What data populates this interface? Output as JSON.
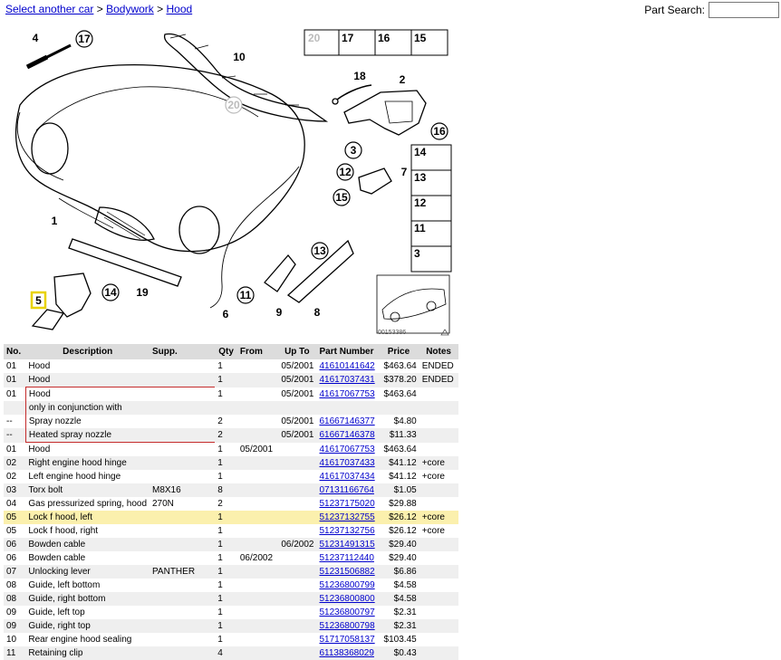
{
  "breadcrumb": {
    "link1": "Select another car",
    "sep1": ">",
    "link2": "Bodywork",
    "sep2": ">",
    "link3": "Hood"
  },
  "search": {
    "label": "Part Search:",
    "value": ""
  },
  "diagram": {
    "image_code": "00153386",
    "callouts": [
      "1",
      "2",
      "3",
      "4",
      "5",
      "6",
      "7",
      "8",
      "9",
      "10",
      "11",
      "12",
      "13",
      "14",
      "15",
      "16",
      "17",
      "18",
      "19",
      "20"
    ],
    "legend_top": [
      "20",
      "17",
      "16",
      "15"
    ],
    "legend_side": [
      "14",
      "13",
      "12",
      "11",
      "3"
    ],
    "highlight_color": "#e8d200"
  },
  "table": {
    "headers": {
      "no": "No.",
      "desc": "Description",
      "supp": "Supp.",
      "qty": "Qty",
      "from": "From",
      "upto": "Up To",
      "pn": "Part Number",
      "price": "Price",
      "notes": "Notes"
    },
    "rows": [
      {
        "no": "01",
        "desc": "Hood",
        "supp": "",
        "qty": "1",
        "from": "",
        "upto": "05/2001",
        "pn": "41610141642",
        "price": "$463.64",
        "notes": "ENDED"
      },
      {
        "no": "01",
        "desc": "Hood",
        "supp": "",
        "qty": "1",
        "from": "",
        "upto": "05/2001",
        "pn": "41617037431",
        "price": "$378.20",
        "notes": "ENDED"
      },
      {
        "no": "01",
        "desc": "Hood",
        "supp": "",
        "qty": "1",
        "from": "",
        "upto": "05/2001",
        "pn": "41617067753",
        "price": "$463.64",
        "notes": ""
      },
      {
        "no": "",
        "desc": "only in conjunction with",
        "supp": "",
        "qty": "",
        "from": "",
        "upto": "",
        "pn": "",
        "price": "",
        "notes": ""
      },
      {
        "no": "--",
        "desc": "Spray nozzle",
        "supp": "",
        "qty": "2",
        "from": "",
        "upto": "05/2001",
        "pn": "61667146377",
        "price": "$4.80",
        "notes": ""
      },
      {
        "no": "--",
        "desc": "Heated spray nozzle",
        "supp": "",
        "qty": "2",
        "from": "",
        "upto": "05/2001",
        "pn": "61667146378",
        "price": "$11.33",
        "notes": ""
      },
      {
        "no": "01",
        "desc": "Hood",
        "supp": "",
        "qty": "1",
        "from": "05/2001",
        "upto": "",
        "pn": "41617067753",
        "price": "$463.64",
        "notes": ""
      },
      {
        "no": "02",
        "desc": "Right engine hood hinge",
        "supp": "",
        "qty": "1",
        "from": "",
        "upto": "",
        "pn": "41617037433",
        "price": "$41.12",
        "notes": "+core"
      },
      {
        "no": "02",
        "desc": "Left engine hood hinge",
        "supp": "",
        "qty": "1",
        "from": "",
        "upto": "",
        "pn": "41617037434",
        "price": "$41.12",
        "notes": "+core"
      },
      {
        "no": "03",
        "desc": "Torx bolt",
        "supp": "M8X16",
        "qty": "8",
        "from": "",
        "upto": "",
        "pn": "07131166764",
        "price": "$1.05",
        "notes": ""
      },
      {
        "no": "04",
        "desc": "Gas pressurized spring, hood",
        "supp": "270N",
        "qty": "2",
        "from": "",
        "upto": "",
        "pn": "51237175020",
        "price": "$29.88",
        "notes": ""
      },
      {
        "no": "05",
        "desc": "Lock f hood, left",
        "supp": "",
        "qty": "1",
        "from": "",
        "upto": "",
        "pn": "51237132755",
        "price": "$26.12",
        "notes": "+core"
      },
      {
        "no": "05",
        "desc": "Lock f hood, right",
        "supp": "",
        "qty": "1",
        "from": "",
        "upto": "",
        "pn": "51237132756",
        "price": "$26.12",
        "notes": "+core"
      },
      {
        "no": "06",
        "desc": "Bowden cable",
        "supp": "",
        "qty": "1",
        "from": "",
        "upto": "06/2002",
        "pn": "51231491315",
        "price": "$29.40",
        "notes": ""
      },
      {
        "no": "06",
        "desc": "Bowden cable",
        "supp": "",
        "qty": "1",
        "from": "06/2002",
        "upto": "",
        "pn": "51237112440",
        "price": "$29.40",
        "notes": ""
      },
      {
        "no": "07",
        "desc": "Unlocking lever",
        "supp": "PANTHER",
        "qty": "1",
        "from": "",
        "upto": "",
        "pn": "51231506882",
        "price": "$6.86",
        "notes": ""
      },
      {
        "no": "08",
        "desc": "Guide, left bottom",
        "supp": "",
        "qty": "1",
        "from": "",
        "upto": "",
        "pn": "51236800799",
        "price": "$4.58",
        "notes": ""
      },
      {
        "no": "08",
        "desc": "Guide, right bottom",
        "supp": "",
        "qty": "1",
        "from": "",
        "upto": "",
        "pn": "51236800800",
        "price": "$4.58",
        "notes": ""
      },
      {
        "no": "09",
        "desc": "Guide, left top",
        "supp": "",
        "qty": "1",
        "from": "",
        "upto": "",
        "pn": "51236800797",
        "price": "$2.31",
        "notes": ""
      },
      {
        "no": "09",
        "desc": "Guide, right top",
        "supp": "",
        "qty": "1",
        "from": "",
        "upto": "",
        "pn": "51236800798",
        "price": "$2.31",
        "notes": ""
      },
      {
        "no": "10",
        "desc": "Rear engine hood sealing",
        "supp": "",
        "qty": "1",
        "from": "",
        "upto": "",
        "pn": "51717058137",
        "price": "$103.45",
        "notes": ""
      },
      {
        "no": "11",
        "desc": "Retaining clip",
        "supp": "",
        "qty": "4",
        "from": "",
        "upto": "",
        "pn": "61138368029",
        "price": "$0.43",
        "notes": ""
      }
    ]
  }
}
